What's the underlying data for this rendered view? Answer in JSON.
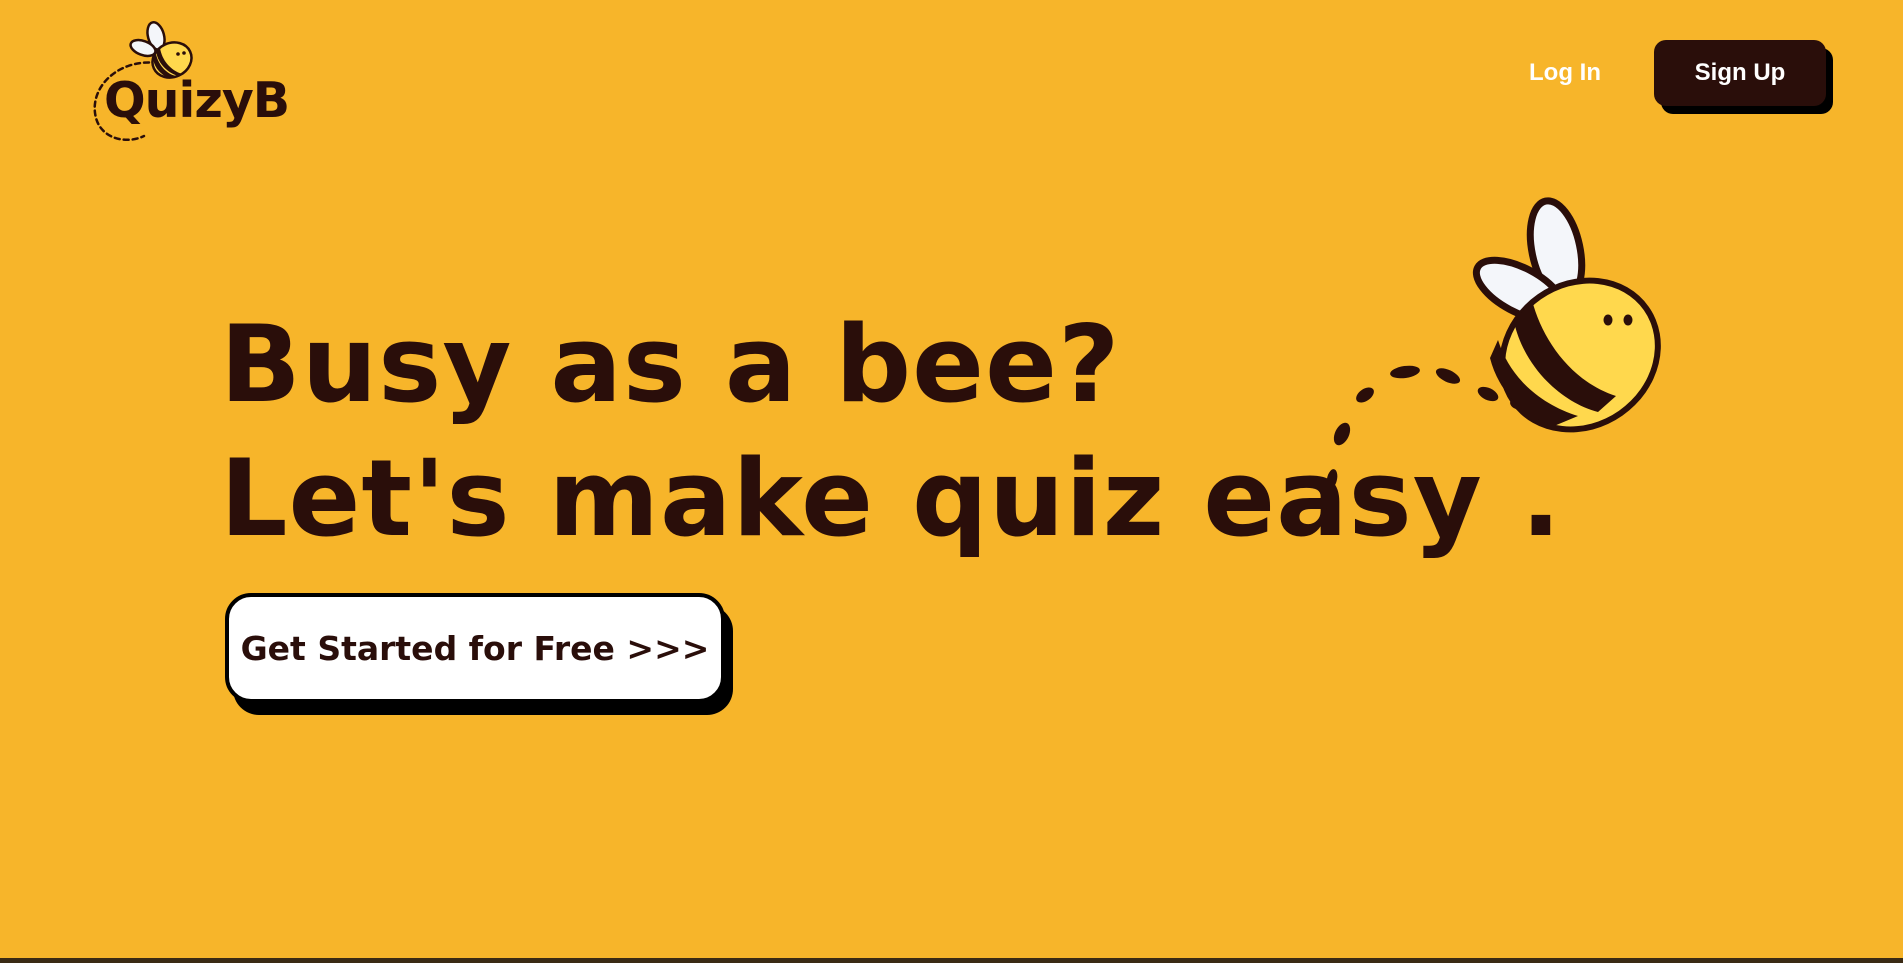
{
  "header": {
    "logo_text": "QuizyB",
    "login_label": "Log In",
    "signup_label": "Sign Up"
  },
  "hero": {
    "line1": "Busy as a bee?",
    "line2": "Let's make quiz easy .",
    "cta_label": "Get Started for Free >>>"
  },
  "icons": {
    "logo": "bee-logo-icon",
    "illustration": "bee-illustration-icon"
  },
  "colors": {
    "background": "#F7B52A",
    "text_dark": "#2A0E0A",
    "button_dark": "#2A0E0A",
    "button_light": "#FFFFFF",
    "bee_yellow": "#FFD84D"
  }
}
